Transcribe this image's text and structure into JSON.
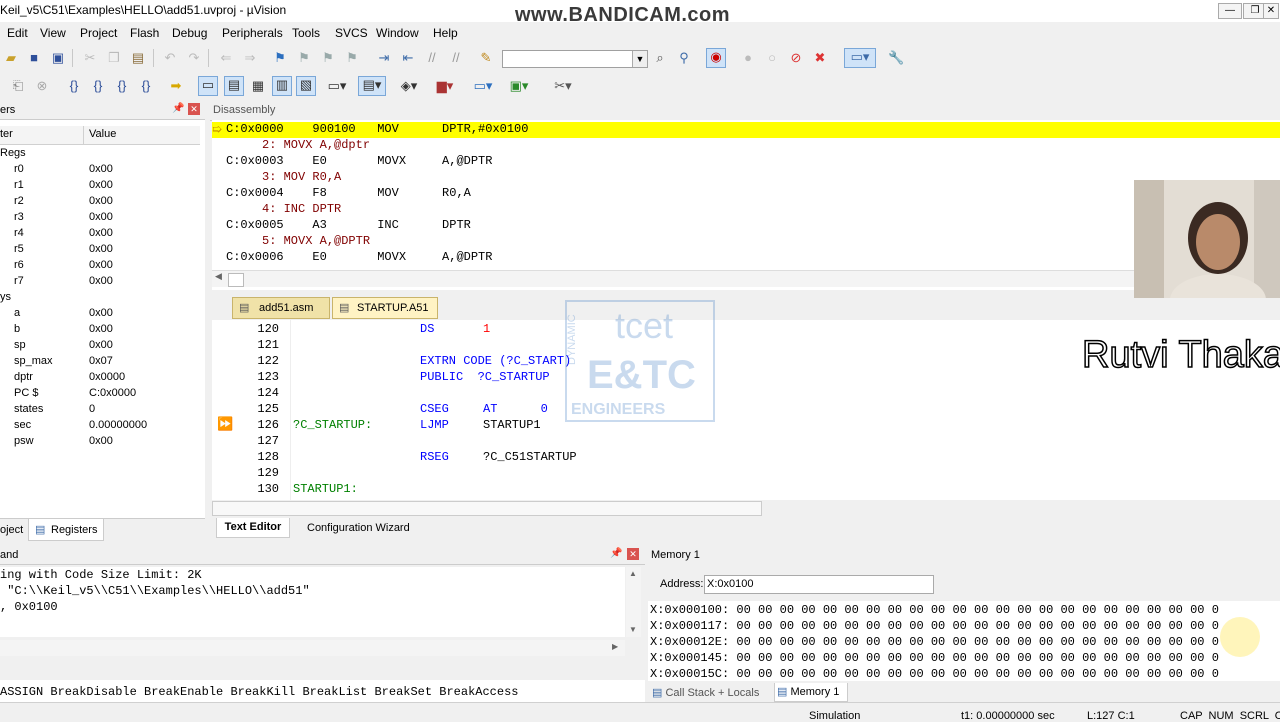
{
  "window": {
    "title": "Keil_v5\\C51\\Examples\\HELLO\\add51.uvproj - µVision",
    "watermark": "www.BANDICAM.com"
  },
  "menu": [
    "Edit",
    "View",
    "Project",
    "Flash",
    "Debug",
    "Peripherals",
    "Tools",
    "SVCS",
    "Window",
    "Help"
  ],
  "registers": {
    "title": "ers",
    "col_register": "ter",
    "col_value": "Value",
    "group_regs": "Regs",
    "group_sys": "ys",
    "rows": [
      {
        "name": "r0",
        "value": "0x00"
      },
      {
        "name": "r1",
        "value": "0x00"
      },
      {
        "name": "r2",
        "value": "0x00"
      },
      {
        "name": "r3",
        "value": "0x00"
      },
      {
        "name": "r4",
        "value": "0x00"
      },
      {
        "name": "r5",
        "value": "0x00"
      },
      {
        "name": "r6",
        "value": "0x00"
      },
      {
        "name": "r7",
        "value": "0x00"
      }
    ],
    "sys_rows": [
      {
        "name": "a",
        "value": "0x00"
      },
      {
        "name": "b",
        "value": "0x00"
      },
      {
        "name": "sp",
        "value": "0x00"
      },
      {
        "name": "sp_max",
        "value": "0x07"
      },
      {
        "name": "dptr",
        "value": "0x0000"
      },
      {
        "name": "PC  $",
        "value": "C:0x0000"
      },
      {
        "name": "states",
        "value": "0"
      },
      {
        "name": "sec",
        "value": "0.00000000"
      },
      {
        "name": "psw",
        "value": "0x00"
      }
    ],
    "tabs": [
      "oject",
      "Registers"
    ]
  },
  "disassembly": {
    "title": "Disassembly",
    "lines": [
      "C:0x0000    900100   MOV      DPTR,#0x0100",
      "     2: MOVX A,@dptr",
      "C:0x0003    E0       MOVX     A,@DPTR",
      "     3: MOV R0,A",
      "C:0x0004    F8       MOV      R0,A",
      "     4: INC DPTR",
      "C:0x0005    A3       INC      DPTR",
      "     5: MOVX A,@DPTR",
      "C:0x0006    E0       MOVX     A,@DPTR"
    ]
  },
  "file_tabs": [
    "add51.asm",
    "STARTUP.A51"
  ],
  "editor": {
    "lines": [
      {
        "no": "120",
        "label": "",
        "op": "DS",
        "arg": "1"
      },
      {
        "no": "121",
        "label": "",
        "op": "",
        "arg": ""
      },
      {
        "no": "122",
        "label": "",
        "op": "EXTRN CODE (?C_START)",
        "arg": ""
      },
      {
        "no": "123",
        "label": "",
        "op": "PUBLIC  ?C_STARTUP",
        "arg": ""
      },
      {
        "no": "124",
        "label": "",
        "op": "",
        "arg": ""
      },
      {
        "no": "125",
        "label": "",
        "op": "CSEG",
        "arg": "AT      0"
      },
      {
        "no": "126",
        "label": "?C_STARTUP:",
        "op": "LJMP",
        "arg": "STARTUP1"
      },
      {
        "no": "127",
        "label": "",
        "op": "",
        "arg": ""
      },
      {
        "no": "128",
        "label": "",
        "op": "RSEG",
        "arg": "?C_C51STARTUP"
      },
      {
        "no": "129",
        "label": "",
        "op": "",
        "arg": ""
      },
      {
        "no": "130",
        "label": "STARTUP1:",
        "op": "",
        "arg": ""
      }
    ],
    "bottom_tabs": [
      "Text Editor",
      "Configuration Wizard"
    ]
  },
  "command": {
    "title": "and",
    "lines": [
      "ing with Code Size Limit: 2K",
      " \"C:\\\\Keil_v5\\\\C51\\\\Examples\\\\HELLO\\\\add51\"",
      ", 0x0100"
    ],
    "hint": "ASSIGN BreakDisable BreakEnable BreakKill BreakList BreakSet BreakAccess"
  },
  "memory": {
    "title": "Memory 1",
    "address_label": "Address:",
    "address_value": "X:0x0100",
    "rows": [
      "X:0x000100: 00 00 00 00 00 00 00 00 00 00 00 00 00 00 00 00 00 00 00 00 00 00 0",
      "X:0x000117: 00 00 00 00 00 00 00 00 00 00 00 00 00 00 00 00 00 00 00 00 00 00 0",
      "X:0x00012E: 00 00 00 00 00 00 00 00 00 00 00 00 00 00 00 00 00 00 00 00 00 00 0",
      "X:0x000145: 00 00 00 00 00 00 00 00 00 00 00 00 00 00 00 00 00 00 00 00 00 00 0",
      "X:0x00015C: 00 00 00 00 00 00 00 00 00 00 00 00 00 00 00 00 00 00 00 00 00 00 0"
    ],
    "tabs": [
      "Call Stack + Locals",
      "Memory 1"
    ]
  },
  "status": {
    "mode": "Simulation",
    "time": "t1: 0.00000000 sec",
    "position": "L:127 C:1",
    "flags": "CAP  NUM  SCRL  OV"
  },
  "overlay_name": "Rutvi Thaka",
  "watermark_logo": [
    "tcet",
    "E&TC",
    "ENGINEERS",
    "DYNAMIC"
  ]
}
